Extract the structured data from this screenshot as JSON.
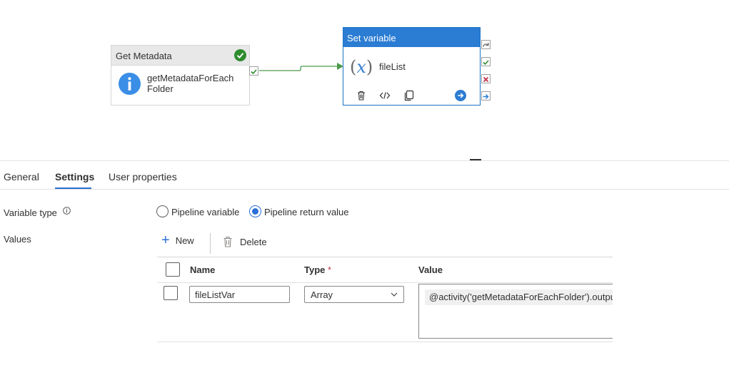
{
  "canvas": {
    "get_metadata": {
      "type_label": "Get Metadata",
      "name": "getMetadataForEachFolder",
      "status": "succeeded"
    },
    "set_variable": {
      "type_label": "Set variable",
      "name": "fileList",
      "icon_text": "x",
      "actions": [
        "delete-icon",
        "code-icon",
        "copy-icon",
        "go-icon"
      ]
    },
    "colors": {
      "accent": "#2b7cd3",
      "success": "#2e8b2e",
      "fail": "#c4314b",
      "connector": "#4a9a4a"
    }
  },
  "tabs": [
    {
      "label": "General",
      "active": false
    },
    {
      "label": "Settings",
      "active": true
    },
    {
      "label": "User properties",
      "active": false
    }
  ],
  "settings": {
    "variable_type_label": "Variable type",
    "variable_type_options": [
      {
        "label": "Pipeline variable",
        "selected": false
      },
      {
        "label": "Pipeline return value",
        "selected": true
      }
    ],
    "values_label": "Values",
    "toolbar": {
      "new_label": "New",
      "delete_label": "Delete"
    },
    "grid": {
      "columns": {
        "name": "Name",
        "type": "Type",
        "type_required": "*",
        "value": "Value"
      },
      "rows": [
        {
          "name": "fileListVar",
          "type": "Array",
          "value": "@activity('getMetadataForEachFolder').output"
        }
      ]
    }
  }
}
